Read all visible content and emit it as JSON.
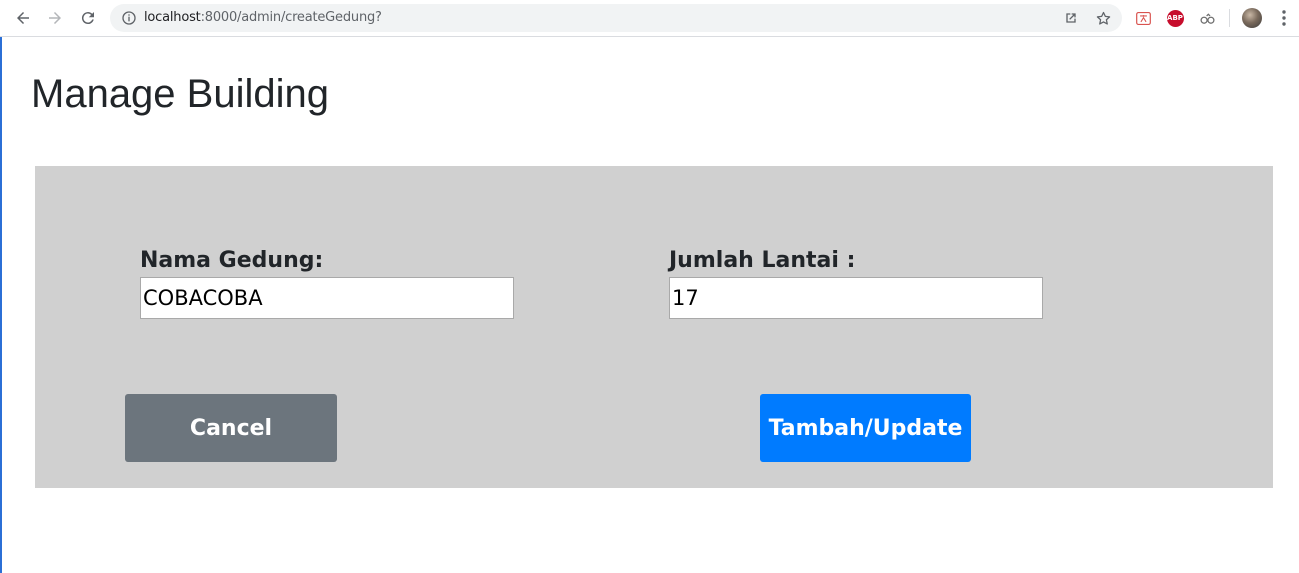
{
  "browser": {
    "url_host": "localhost",
    "url_rest": ":8000/admin/createGedung?",
    "extensions": [
      "translate-icon",
      "adblock-plus-icon",
      "extension-icon"
    ],
    "abp_label": "ABP"
  },
  "page": {
    "title": "Manage Building"
  },
  "form": {
    "nama_label": "Nama Gedung:",
    "nama_value": "COBACOBA",
    "lantai_label": "Jumlah Lantai :",
    "lantai_value": "17",
    "cancel_label": "Cancel",
    "submit_label": "Tambah/Update"
  },
  "colors": {
    "panel_bg": "#d0d0d0",
    "cancel_bg": "#6c757d",
    "submit_bg": "#007bff"
  }
}
